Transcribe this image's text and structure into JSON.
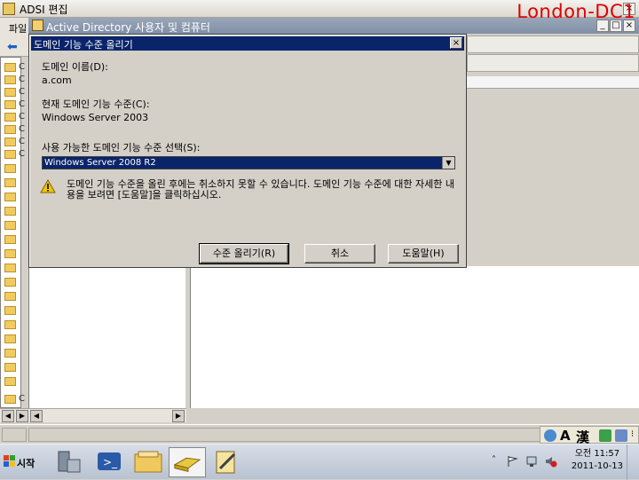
{
  "adsi_window": {
    "title": "ADSI 편집",
    "menu_first": "파일",
    "watermark": "London-DC1"
  },
  "aduc_window": {
    "title": "Active Directory 사용자 및 컴퓨터"
  },
  "left_tree": {
    "item_prefix": "C",
    "bottom_item": "C"
  },
  "dialog": {
    "title": "도메인 기능 수준 올리기",
    "domain_name_label": "도메인 이름(D):",
    "domain_name_value": "a.com",
    "current_level_label": "현재 도메인 기능 수준(C):",
    "current_level_value": "Windows Server 2003",
    "select_label": "사용 가능한 도메인 기능 수준 선택(S):",
    "select_value": "Windows Server 2008 R2",
    "warning_text": "도메인 기능 수준을 올린 후에는 취소하지 못할 수 있습니다. 도메인 기능 수준에 대한 자세한 내용을 보려면 [도움말]을 클릭하십시오.",
    "buttons": {
      "raise": "수준 올리기(R)",
      "cancel": "취소",
      "help": "도움말(H)"
    }
  },
  "language_bar": {
    "mode": "A",
    "hanja": "漢"
  },
  "taskbar": {
    "start_label": "시작",
    "clock_ampm": "오전",
    "clock_time": "11:57",
    "clock_date": "2011-10-13"
  }
}
